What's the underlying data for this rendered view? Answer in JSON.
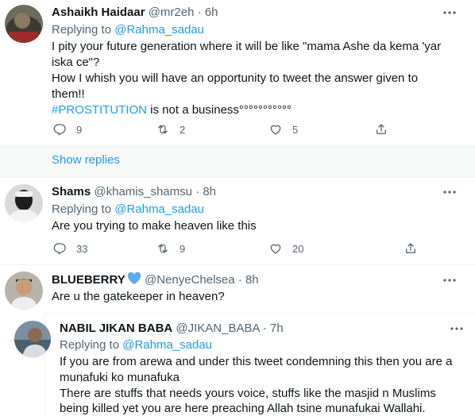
{
  "tweets": [
    {
      "name": "Ashaikh Haidaar",
      "handle": "@mr2eh",
      "time": "6h",
      "replying_label": "Replying to ",
      "replying_to": "@Rahma_sadau",
      "lines": [
        "I  pity your future generation where it will be like \"mama Ashe da kema 'yar",
        "iska ce\"?",
        "How I whish you will have an opportunity to tweet the answer given to",
        "them!!"
      ],
      "hashtag": "#PROSTITUTION",
      "hashtag_rest": " is not a business°°°°°°°°°°°",
      "replies": "9",
      "retweets": "2",
      "likes": "5"
    },
    {
      "name": "Shams",
      "handle": "@khamis_shamsu",
      "time": "8h",
      "replying_label": "Replying to ",
      "replying_to": "@Rahma_sadau",
      "lines": [
        "Are you trying to make heaven like this"
      ],
      "replies": "33",
      "retweets": "9",
      "likes": "20"
    },
    {
      "name": "BLUEBERRY",
      "handle": "@NenyeChelsea",
      "time": "8h",
      "lines": [
        "Are u the gatekeeper in heaven?"
      ]
    },
    {
      "name": "NABIL JIKAN BABA",
      "handle": "@JIKAN_BABA",
      "time": "7h",
      "replying_label": "Replying to ",
      "replying_to": "@Rahma_sadau",
      "lines": [
        "If you are from arewa and under this tweet condemning this then you are a",
        "munafuki ko munafuka",
        "There are stuffs that needs yours voice, stuffs like the masjid n Muslims",
        "being killed yet you are here preaching Allah tsine munafukai Wallahi."
      ]
    }
  ],
  "show_replies": "Show replies",
  "sep": "·",
  "colors": {
    "accent": "#1d9bf0",
    "muted": "#536471",
    "heart_emoji": "#5dadec"
  },
  "icons": [
    "more-icon",
    "reply-icon",
    "retweet-icon",
    "like-icon",
    "share-icon",
    "blue-heart-emoji"
  ]
}
